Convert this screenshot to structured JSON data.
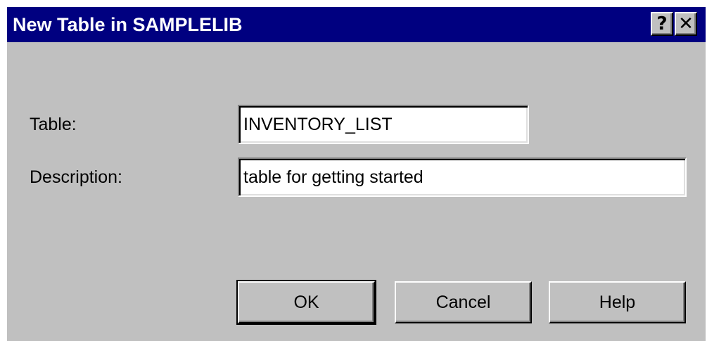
{
  "window": {
    "title": "New Table in SAMPLELIB",
    "help_glyph": "?",
    "close_glyph": "✕",
    "titlebar_color": "#000080",
    "face_color": "#c0c0c0"
  },
  "form": {
    "table_label": "Table:",
    "table_value": "INVENTORY_LIST",
    "description_label": "Description:",
    "description_value": "table for getting started"
  },
  "buttons": {
    "ok_label": "OK",
    "cancel_label": "Cancel",
    "help_label": "Help"
  }
}
